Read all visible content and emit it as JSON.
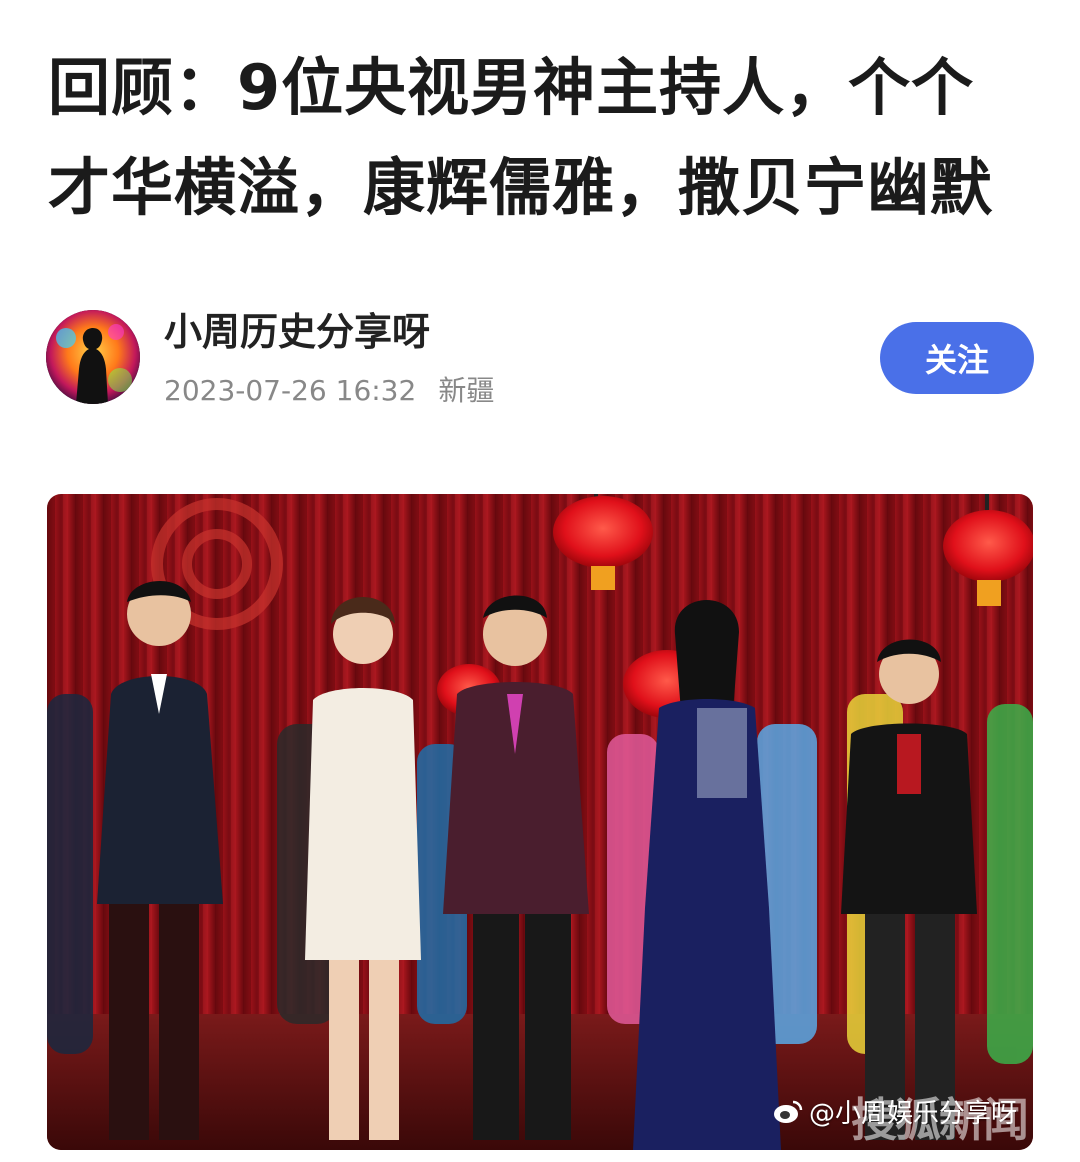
{
  "article": {
    "title_line1": "回顾：9位央视男神主持人，个个",
    "title_line2": "才华横溢，康辉儒雅，撒贝宁幽默"
  },
  "author": {
    "name": "小周历史分享呀",
    "date": "2023-07-26 16:32",
    "location": "新疆",
    "follow_label": "关注",
    "avatar_icon": "silhouette-avatar"
  },
  "image": {
    "watermark_text": "@小周娱乐分享呀",
    "watermark_icon": "weibo-icon",
    "corner_text": "搜狐新闻"
  },
  "colors": {
    "accent": "#4a70e8",
    "stage_red": "#8e0f16"
  }
}
